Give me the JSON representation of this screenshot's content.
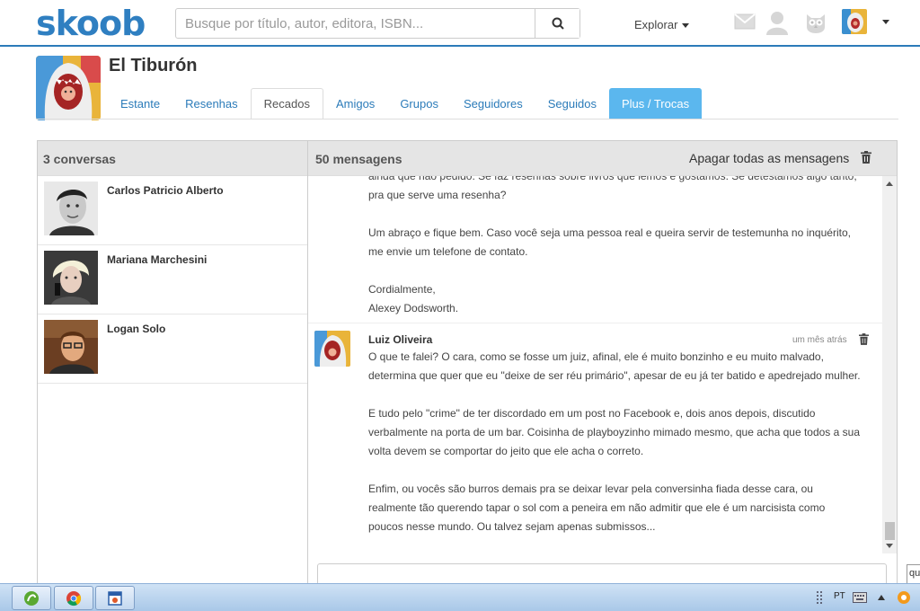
{
  "header": {
    "logo": "skoob",
    "search_placeholder": "Busque por título, autor, editora, ISBN...",
    "explore_label": "Explorar"
  },
  "profile": {
    "name": "El Tiburón",
    "tabs": [
      "Estante",
      "Resenhas",
      "Recados",
      "Amigos",
      "Grupos",
      "Seguidores",
      "Seguidos",
      "Plus / Trocas"
    ],
    "active_tab": "Recados"
  },
  "conversations": {
    "header": "3 conversas",
    "items": [
      {
        "name": "Carlos Patricio Alberto"
      },
      {
        "name": "Mariana Marchesini"
      },
      {
        "name": "Logan Solo"
      }
    ]
  },
  "messages": {
    "header": "50 mensagens",
    "delete_all_label": "Apagar todas as mensagens",
    "msg1": {
      "line0": "ainda que não pedido. Se faz resenhas sobre livros que lemos e gostamos. Se detestamos algo tanto,",
      "line1": "pra que serve uma resenha?",
      "p2a": "Um abraço e fique bem. Caso você seja uma pessoa real e queira servir de testemunha no inquérito,",
      "p2b": "me envie um telefone de contato.",
      "p3a": "Cordialmente,",
      "p3b": "Alexey Dodsworth."
    },
    "msg2": {
      "author": "Luiz Oliveira",
      "time": "um mês atrás",
      "p1a": "O que te falei? O cara, como se fosse um juiz, afinal, ele é muito bonzinho e eu muito malvado,",
      "p1b": "determina que quer que eu \"deixe de ser réu primário\", apesar de eu já ter batido e apedrejado mulher.",
      "p2a": "E tudo pelo \"crime\" de ter discordado em um post no Facebook e, dois anos depois, discutido",
      "p2b": "verbalmente na porta de um bar. Coisinha de playboyzinho mimado mesmo, que acha que todos a sua",
      "p2c": "volta devem se comportar do jeito que ele acha o correto.",
      "p3a": "Enfim, ou vocês são burros demais pra se deixar levar pela conversinha fiada desse cara, ou",
      "p3b": "realmente tão querendo tapar o sol com a peneira em não admitir que ele é um narcisista como",
      "p3c": "poucos nesse mundo. Ou talvez sejam apenas submissos..."
    }
  },
  "side_tag": "qu",
  "taskbar": {
    "language": "PT"
  },
  "colors": {
    "brand_blue": "#2f7fc1",
    "plus_tab": "#5bb7ee",
    "link": "#2b7bb9"
  }
}
